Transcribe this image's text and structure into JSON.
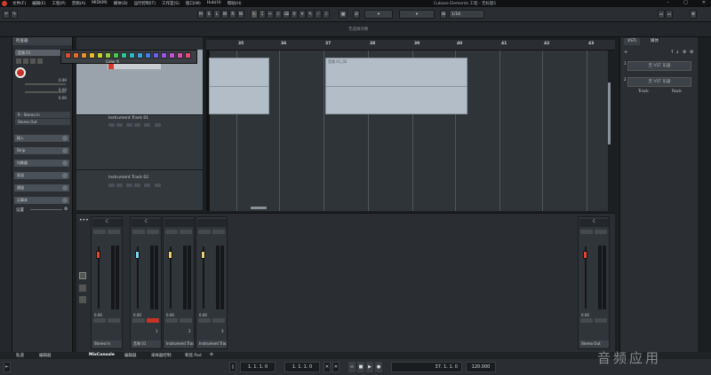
{
  "menu": {
    "items": [
      "文件(F)",
      "编辑(E)",
      "工程(P)",
      "音频(A)",
      "MIDI(M)",
      "媒体(D)",
      "运行控制(T)",
      "工作室(S)",
      "窗口(W)",
      "Hub(H)",
      "帮助(H)"
    ],
    "window_title": "Cubase Elements 工程 - 无标题1"
  },
  "toolbar": {
    "mode_buttons": [
      "M",
      "S",
      "L",
      "W",
      "R",
      "W"
    ],
    "snap_value": "1/16"
  },
  "infoline": {
    "text": "无选择对象"
  },
  "left_zone": {
    "title": "检查器",
    "track_name": "音频 01",
    "routing_in": "R - Stereo In",
    "routing_out": "Stereo Out",
    "value_1": "0.00",
    "value_2": "0.00",
    "value_3": "0.00",
    "sections": [
      "插入",
      "Strip",
      "均衡器",
      "发送",
      "通道",
      "记事本"
    ],
    "footer": "设置"
  },
  "palette": {
    "label": "Color 6",
    "colors": [
      "#d84a3a",
      "#e06b2d",
      "#e7932d",
      "#e5bd2e",
      "#c9d32c",
      "#8fd03a",
      "#48c64d",
      "#2fc495",
      "#2fb9c8",
      "#3aa0e0",
      "#3f7fe6",
      "#6b5fe8",
      "#9b55e6",
      "#c452d6",
      "#e04fb0",
      "#e84a7c"
    ]
  },
  "tracks": [
    {
      "name": "Instrument Track 01"
    },
    {
      "name": "Instrument Track 02"
    }
  ],
  "ruler": {
    "bars": [
      "35",
      "36",
      "37",
      "38",
      "39",
      "40",
      "41",
      "42",
      "43"
    ]
  },
  "events": [
    {
      "label": ""
    },
    {
      "label": "音频 01_02"
    }
  ],
  "right_zone": {
    "tab_vsti": "VSTi",
    "tab_media": "媒体",
    "slot1": "无 VST 乐器",
    "slot2": "无 VST 乐器",
    "track_label": "Track",
    "rack_label": "Rack"
  },
  "mixer": {
    "channels": [
      {
        "name": "Stereo In",
        "num": "",
        "pan": "C",
        "value": "0.00"
      },
      {
        "name": "音频 01",
        "num": "1",
        "pan": "C",
        "value": "0.00"
      },
      {
        "name": "Instrument Trac",
        "num": "2",
        "pan": "C",
        "value": "0.00"
      },
      {
        "name": "Instrument Trac",
        "num": "3",
        "pan": "C",
        "value": "0.00"
      },
      {
        "name": "Stereo Out",
        "num": "",
        "pan": "C",
        "value": "0.00"
      }
    ]
  },
  "bottom_tabs": [
    "轨道",
    "编辑器",
    "MixConsole",
    "编辑器",
    "采样器控制",
    "和弦 Pad"
  ],
  "transport": {
    "pos_left": "1. 1. 1.  0",
    "pos_right": "1. 1. 1.  0",
    "time_sig_pos": "37. 1. 1.  0",
    "tempo": "120.000"
  },
  "watermark": "音频应用"
}
